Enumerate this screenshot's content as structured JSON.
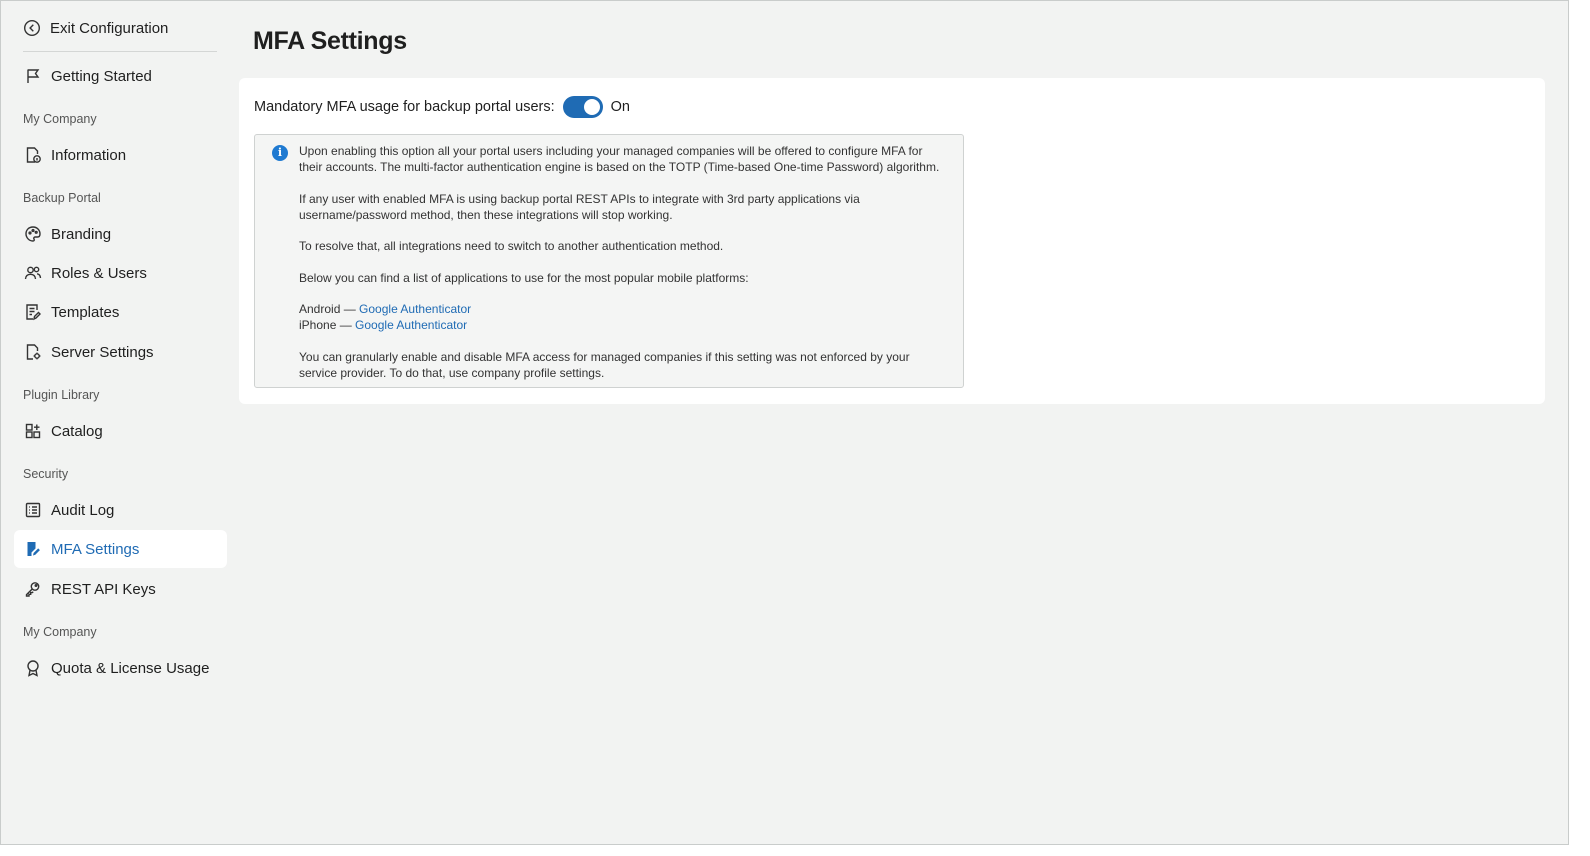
{
  "sidebar": {
    "exit_label": "Exit Configuration",
    "getting_started": "Getting Started",
    "sections": {
      "my_company": "My Company",
      "backup_portal": "Backup Portal",
      "plugin_library": "Plugin Library",
      "security": "Security",
      "my_company_2": "My Company"
    },
    "items": {
      "information": "Information",
      "branding": "Branding",
      "roles_users": "Roles & Users",
      "templates": "Templates",
      "server_settings": "Server Settings",
      "catalog": "Catalog",
      "audit_log": "Audit Log",
      "mfa_settings": "MFA Settings",
      "rest_api_keys": "REST API Keys",
      "quota_license": "Quota & License Usage"
    },
    "active_item": "MFA Settings"
  },
  "main": {
    "title": "MFA Settings",
    "mfa_label": "Mandatory MFA usage for backup portal users:",
    "mfa_enabled": true,
    "mfa_state": "On",
    "info": {
      "p1": "Upon enabling this option all your portal users including your managed companies will be offered to configure MFA for their accounts. The multi-factor authentication engine is based on the TOTP (Time-based One-time Password) algorithm.",
      "p2": "If any user with enabled MFA is using backup portal REST APIs to integrate with 3rd party applications via username/password method, then these integrations will stop working.",
      "p3": "To resolve that, all integrations need to switch to another authentication method.",
      "p4": "Below you can find a list of applications to use for the most popular mobile platforms:",
      "android_label": "Android —",
      "android_link": "Google Authenticator",
      "iphone_label": "iPhone —",
      "iphone_link": "Google Authenticator",
      "p5": "You can granularly enable and disable MFA access for managed companies if this setting was not enforced by your service provider. To do that, use company profile settings."
    }
  },
  "colors": {
    "accent": "#1f6bb4",
    "background": "#f2f3f2",
    "card": "#ffffff",
    "info_icon": "#1f7ad1"
  }
}
